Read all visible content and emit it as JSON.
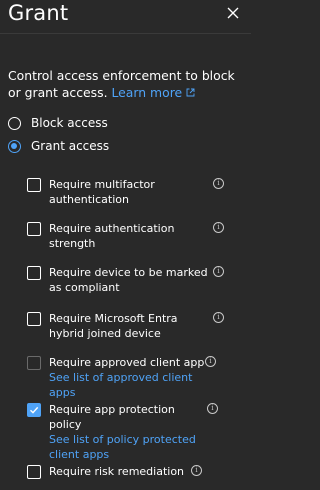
{
  "panel": {
    "title": "Grant",
    "description": "Control access enforcement to block or grant access.",
    "learn_more": "Learn more"
  },
  "access_options": [
    {
      "label": "Block access",
      "selected": false
    },
    {
      "label": "Grant access",
      "selected": true
    }
  ],
  "controls": [
    {
      "label": "Require multifactor authentication",
      "checked": false,
      "disabled": false,
      "link": ""
    },
    {
      "label": "Require authentication strength",
      "checked": false,
      "disabled": false,
      "link": ""
    },
    {
      "label": "Require device to be marked as compliant",
      "checked": false,
      "disabled": false,
      "link": ""
    },
    {
      "label": "Require Microsoft Entra hybrid joined device",
      "checked": false,
      "disabled": false,
      "link": ""
    },
    {
      "label": "Require approved client app",
      "checked": false,
      "disabled": true,
      "link": "See list of approved client apps"
    },
    {
      "label": "Require app protection policy",
      "checked": true,
      "disabled": false,
      "link": "See list of policy protected client apps"
    },
    {
      "label": "Require risk remediation",
      "checked": false,
      "disabled": false,
      "link": ""
    }
  ],
  "colors": {
    "background": "#292929",
    "accent": "#4fa3f7",
    "text": "#ffffff"
  },
  "icons": {
    "close": "close-icon",
    "external_link": "external-link-icon",
    "info": "info-icon",
    "checkmark": "checkmark-icon"
  }
}
